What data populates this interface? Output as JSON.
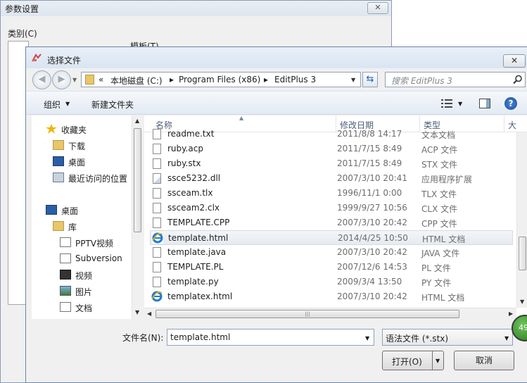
{
  "background_dialog": {
    "title": "参数设置",
    "close_label": "✕",
    "category_label": "类别(C)",
    "template_label": "模板(T)"
  },
  "dialog": {
    "title": "选择文件",
    "close_label": "✕"
  },
  "address_bar": {
    "prefix": "«",
    "segments": [
      "本地磁盘 (C:)",
      "Program Files (x86)",
      "EditPlus 3"
    ],
    "separator": "▸"
  },
  "search": {
    "placeholder": "搜索 EditPlus 3"
  },
  "toolbar": {
    "organize_label": "组织",
    "new_folder_label": "新建文件夹",
    "help_label": "?"
  },
  "nav_pane": {
    "items": [
      {
        "label": "收藏夹",
        "icon": "star-icon"
      },
      {
        "label": "下载",
        "icon": "download-folder-icon"
      },
      {
        "label": "桌面",
        "icon": "desktop-icon"
      },
      {
        "label": "最近访问的位置",
        "icon": "recent-places-icon"
      },
      {
        "label": "桌面",
        "icon": "desktop-icon"
      },
      {
        "label": "库",
        "icon": "library-icon"
      },
      {
        "label": "PPTV视频",
        "icon": "document-icon"
      },
      {
        "label": "Subversion",
        "icon": "document-icon"
      },
      {
        "label": "视频",
        "icon": "video-icon"
      },
      {
        "label": "图片",
        "icon": "picture-icon"
      },
      {
        "label": "文档",
        "icon": "document-icon"
      }
    ]
  },
  "file_list": {
    "columns": {
      "name": "名称",
      "modified": "修改日期",
      "type": "类型",
      "size": "大"
    },
    "rows": [
      {
        "name": "readme.txt",
        "modified": "2011/8/8 14:17",
        "type": "文本文档",
        "icon": "file-icon"
      },
      {
        "name": "ruby.acp",
        "modified": "2011/7/15 8:49",
        "type": "ACP 文件",
        "icon": "file-icon"
      },
      {
        "name": "ruby.stx",
        "modified": "2011/7/15 8:49",
        "type": "STX 文件",
        "icon": "file-icon"
      },
      {
        "name": "ssce5232.dll",
        "modified": "2007/3/10 20:41",
        "type": "应用程序扩展",
        "icon": "dll-icon"
      },
      {
        "name": "ssceam.tlx",
        "modified": "1996/11/1 0:00",
        "type": "TLX 文件",
        "icon": "file-icon"
      },
      {
        "name": "ssceam2.clx",
        "modified": "1999/9/27 10:56",
        "type": "CLX 文件",
        "icon": "file-icon"
      },
      {
        "name": "TEMPLATE.CPP",
        "modified": "2007/3/10 20:42",
        "type": "CPP 文件",
        "icon": "file-icon"
      },
      {
        "name": "template.html",
        "modified": "2014/4/25 10:50",
        "type": "HTML 文档",
        "icon": "ie-icon",
        "selected": true
      },
      {
        "name": "template.java",
        "modified": "2007/3/10 20:42",
        "type": "JAVA 文件",
        "icon": "file-icon"
      },
      {
        "name": "TEMPLATE.PL",
        "modified": "2007/12/6 14:53",
        "type": "PL 文件",
        "icon": "file-icon"
      },
      {
        "name": "template.py",
        "modified": "2009/3/4 13:50",
        "type": "PY 文件",
        "icon": "file-icon"
      },
      {
        "name": "templatex.html",
        "modified": "2007/3/10 20:42",
        "type": "HTML 文档",
        "icon": "ie-icon"
      }
    ]
  },
  "bottom": {
    "filename_label": "文件名(N):",
    "filename_value": "template.html",
    "filetype_value": "语法文件 (*.stx)",
    "open_label": "打开(O)",
    "cancel_label": "取消"
  },
  "badge": {
    "value": "49"
  },
  "colors": {
    "selection": "#e6ebf1",
    "help": "#1e4f9a",
    "badge": "#2d7a22"
  }
}
